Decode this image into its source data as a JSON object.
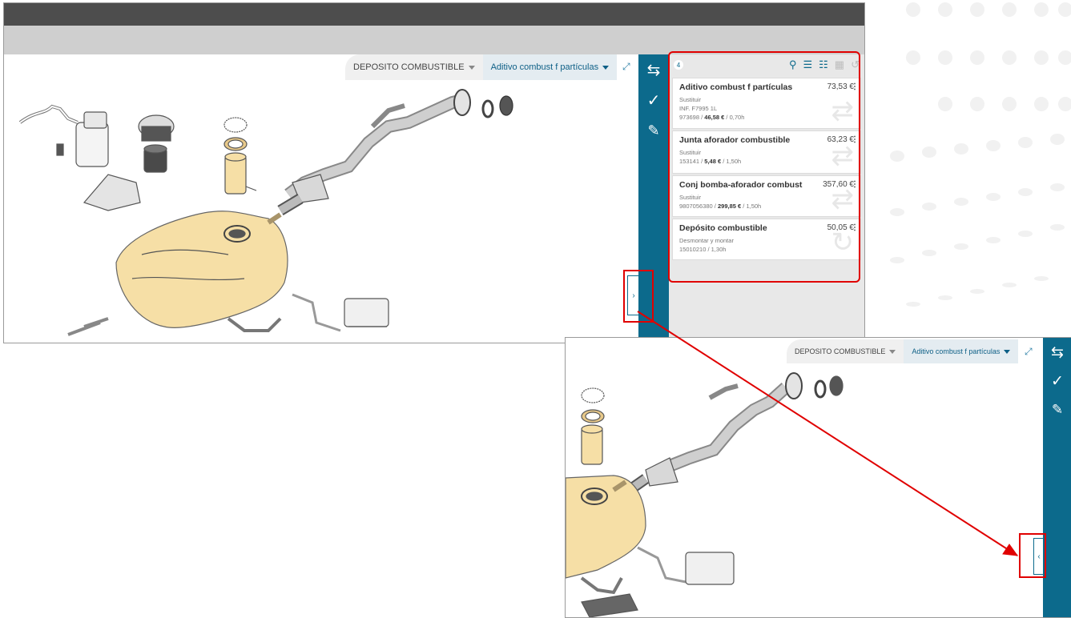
{
  "breadcrumbs": {
    "item1": "DEPOSITO COMBUSTIBLE",
    "item2": "Aditivo combust f partículas"
  },
  "sidebar_icons": [
    "swap-arrows-icon",
    "check-icon",
    "edit-note-icon"
  ],
  "panel": {
    "count": "4",
    "tool_icons": [
      "part-search-icon",
      "list-search-icon",
      "sliders-icon",
      "calculator-icon",
      "undo-icon"
    ]
  },
  "items": [
    {
      "title": "Aditivo combust f partículas",
      "price": "73,53 €",
      "action": "Sustituir",
      "ref": "INF. F7995 1L",
      "code": "973698",
      "unit_price": "46,58 €",
      "hours": "0,70h"
    },
    {
      "title": "Junta aforador combustible",
      "price": "63,23 €",
      "action": "Sustituir",
      "code": "153141",
      "unit_price": "5,48 €",
      "hours": "1,50h"
    },
    {
      "title": "Conj bomba-aforador combust",
      "price": "357,60 €",
      "action": "Sustituir",
      "code": "9807056380",
      "unit_price": "299,85 €",
      "hours": "1,50h"
    },
    {
      "title": "Depósito combustible",
      "price": "50,05 €",
      "action": "Desmontar y montar",
      "code": "15010210",
      "hours": "1,30h"
    }
  ],
  "separators": {
    "slash": " / "
  },
  "toggle": {
    "collapse": "›",
    "expand": "‹"
  },
  "colors": {
    "teal": "#0c6a8c",
    "highlight": "#e00000",
    "tank": "#f6dfa6"
  }
}
